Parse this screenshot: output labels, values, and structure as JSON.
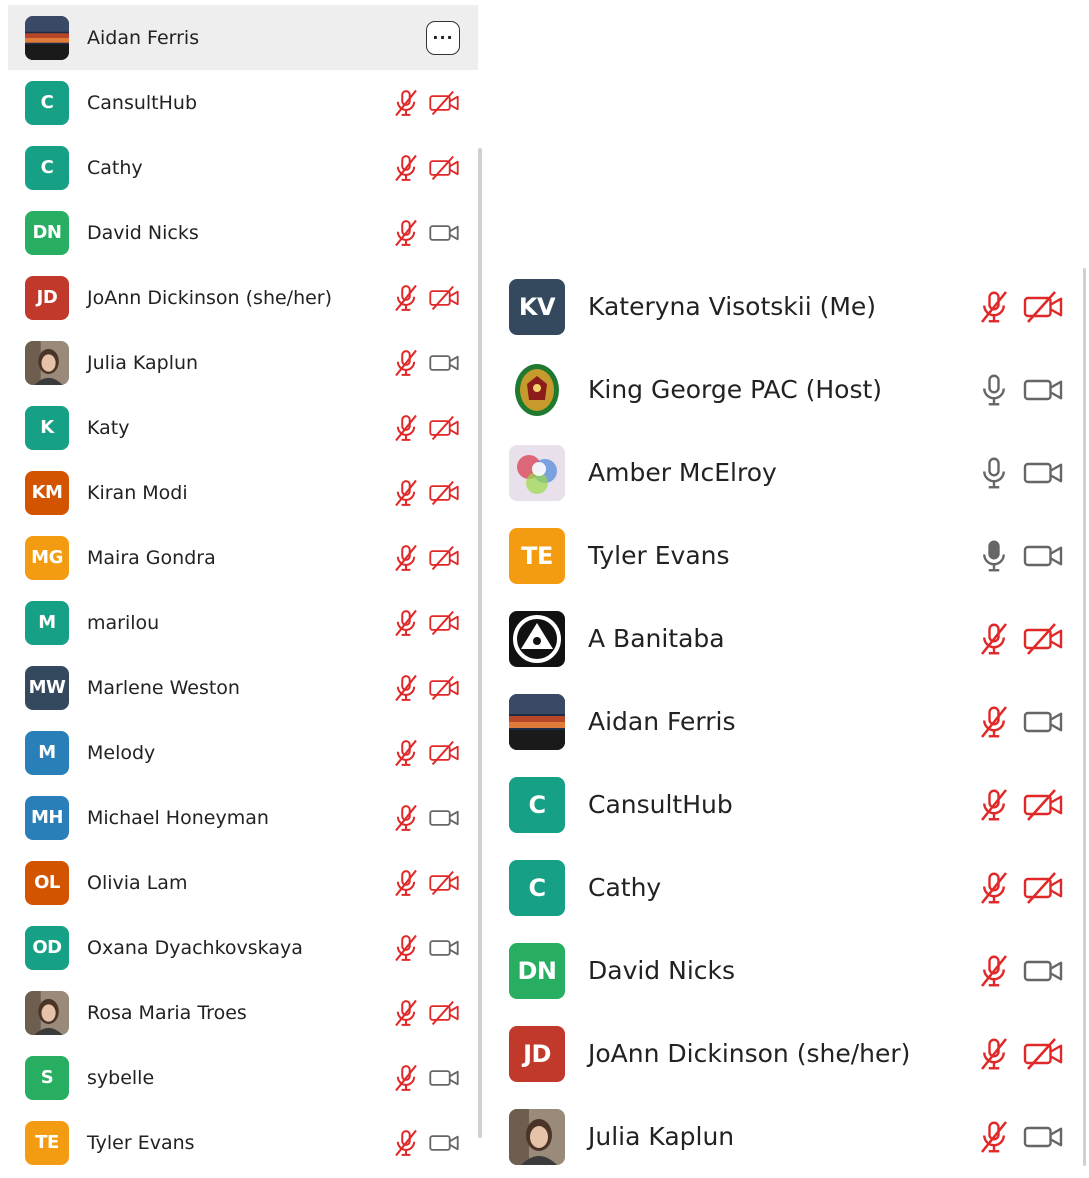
{
  "left_panel": {
    "more_button_label": "···",
    "participants": [
      {
        "name": "Aidan Ferris",
        "avatar": "photo",
        "mic": "muted",
        "video": "on",
        "highlight": true
      },
      {
        "name": "CansultHub",
        "initials": "C",
        "color": "#16a085",
        "mic": "muted",
        "video": "off"
      },
      {
        "name": "Cathy",
        "initials": "C",
        "color": "#16a085",
        "mic": "muted",
        "video": "off"
      },
      {
        "name": "David Nicks",
        "initials": "DN",
        "color": "#27ae60",
        "mic": "muted",
        "video": "on"
      },
      {
        "name": "JoAnn Dickinson (she/her)",
        "initials": "JD",
        "color": "#c0392b",
        "mic": "muted",
        "video": "off"
      },
      {
        "name": "Julia Kaplun",
        "avatar": "photo",
        "mic": "muted",
        "video": "on"
      },
      {
        "name": "Katy",
        "initials": "K",
        "color": "#16a085",
        "mic": "muted",
        "video": "off"
      },
      {
        "name": "Kiran Modi",
        "initials": "KM",
        "color": "#d35400",
        "mic": "muted",
        "video": "off"
      },
      {
        "name": "Maira Gondra",
        "initials": "MG",
        "color": "#f39c12",
        "mic": "muted",
        "video": "off"
      },
      {
        "name": "marilou",
        "initials": "M",
        "color": "#16a085",
        "mic": "muted",
        "video": "off"
      },
      {
        "name": "Marlene Weston",
        "initials": "MW",
        "color": "#34495e",
        "mic": "muted",
        "video": "off"
      },
      {
        "name": "Melody",
        "initials": "M",
        "color": "#2980b9",
        "mic": "muted",
        "video": "off"
      },
      {
        "name": "Michael Honeyman",
        "initials": "MH",
        "color": "#2980b9",
        "mic": "muted",
        "video": "on"
      },
      {
        "name": "Olivia Lam",
        "initials": "OL",
        "color": "#d35400",
        "mic": "muted",
        "video": "off"
      },
      {
        "name": "Oxana Dyachkovskaya",
        "initials": "OD",
        "color": "#16a085",
        "mic": "muted",
        "video": "on"
      },
      {
        "name": "Rosa Maria Troes",
        "avatar": "photo",
        "mic": "muted",
        "video": "off"
      },
      {
        "name": "sybelle",
        "initials": "S",
        "color": "#27ae60",
        "mic": "muted",
        "video": "on"
      },
      {
        "name": "Tyler Evans",
        "initials": "TE",
        "color": "#f39c12",
        "mic": "muted",
        "video": "on"
      }
    ]
  },
  "right_panel": {
    "participants": [
      {
        "name": "Kateryna Visotskii (Me)",
        "initials": "KV",
        "color": "#34495e",
        "mic": "muted",
        "video": "off"
      },
      {
        "name": "King George PAC (Host)",
        "avatar": "crest",
        "mic": "on",
        "video": "on"
      },
      {
        "name": "Amber McElroy",
        "avatar": "photo",
        "mic": "on",
        "video": "on"
      },
      {
        "name": "Tyler Evans",
        "initials": "TE",
        "color": "#f39c12",
        "mic": "speaking",
        "video": "on"
      },
      {
        "name": "A Banitaba",
        "avatar": "logo",
        "mic": "muted",
        "video": "off"
      },
      {
        "name": "Aidan Ferris",
        "avatar": "photo",
        "mic": "muted",
        "video": "on"
      },
      {
        "name": "CansultHub",
        "initials": "C",
        "color": "#16a085",
        "mic": "muted",
        "video": "off"
      },
      {
        "name": "Cathy",
        "initials": "C",
        "color": "#16a085",
        "mic": "muted",
        "video": "off"
      },
      {
        "name": "David Nicks",
        "initials": "DN",
        "color": "#27ae60",
        "mic": "muted",
        "video": "on"
      },
      {
        "name": "JoAnn Dickinson (she/her)",
        "initials": "JD",
        "color": "#c0392b",
        "mic": "muted",
        "video": "off"
      },
      {
        "name": "Julia Kaplun",
        "avatar": "photo",
        "mic": "muted",
        "video": "on"
      }
    ]
  },
  "colors": {
    "muted": "#e02828",
    "neutral": "#666666",
    "highlight": "#eeeeee"
  }
}
